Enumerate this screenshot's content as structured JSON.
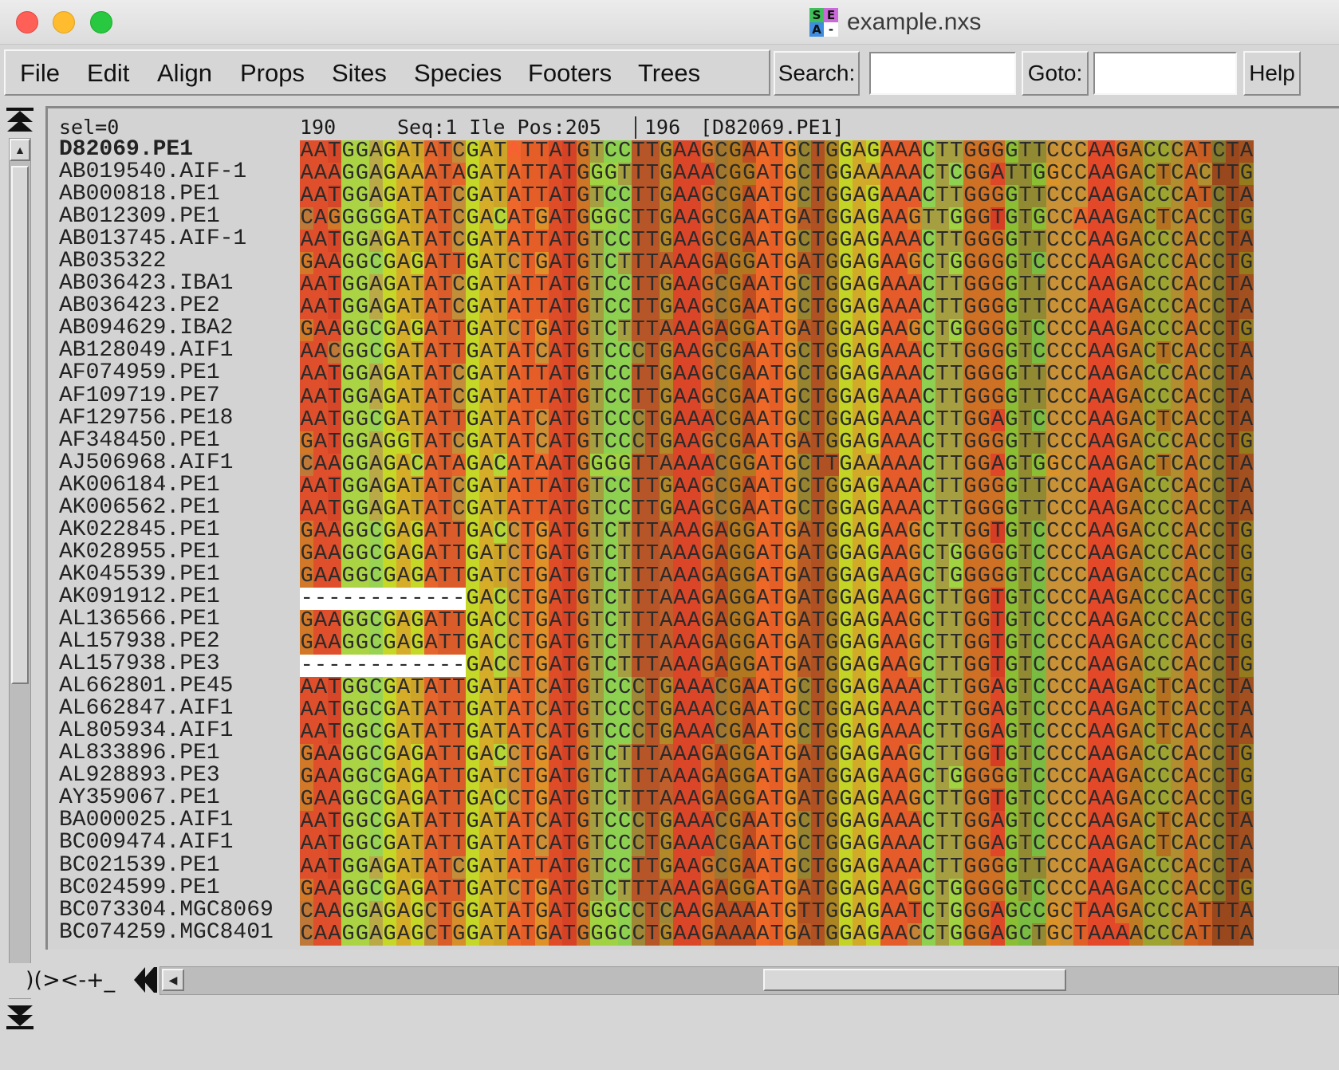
{
  "window": {
    "title": "example.nxs",
    "icon_letters": [
      "S",
      "E",
      "A",
      "-"
    ]
  },
  "menu": {
    "items": [
      "File",
      "Edit",
      "Align",
      "Props",
      "Sites",
      "Species",
      "Footers",
      "Trees"
    ],
    "search_label": "Search:",
    "search_value": "",
    "goto_label": "Goto:",
    "goto_value": "",
    "help_label": "Help"
  },
  "status": {
    "selection": "sel=0",
    "column_start": "190",
    "cursor_info": "Seq:1 Ile Pos:205",
    "cursor_column": "196",
    "cursor_sequence": "[D82069.PE1]"
  },
  "bottom": {
    "gap_symbols": ")(><-+_"
  },
  "colors": {
    "A": "#ed5c2c",
    "C": "#8ed150",
    "G": "#c3d525",
    "T": "#d34125",
    "accent_sequence_highlight": "#111111"
  },
  "alignment": {
    "column_palette": [
      "#d8482a",
      "#9ed455",
      "#c8d928",
      "#e06a2e",
      "#c8d928",
      "#ee6e2a",
      "#d64326",
      "#8ed150",
      "#a7602a",
      "#d33a26",
      "#a9461e",
      "#ee6f26",
      "#9c5a20",
      "#c3d427",
      "#e15a28",
      "#8ed150",
      "#d63b24",
      "#6fb13b",
      "#e8702a",
      "#dd3f28",
      "#a58b1e",
      "#c46a1e",
      "#7a4a18"
    ],
    "rows": [
      {
        "name": "D82069.PE1",
        "seq": "AATGGAGATATCGATATTATGTCCTTGAAGCGAATGCTGGAGAAACTTGGGGTTCCCAAGACCCATCTA",
        "ref": true,
        "cursor": 15
      },
      {
        "name": "AB019540.AIF-1",
        "seq": "AAAGGAGAAATAGATATTATGGGTTTGAAACGGATGCTGGAAAAACTCGGATTGGCCAAGACTCACTTG"
      },
      {
        "name": "AB000818.PE1",
        "seq": "AATGGAGATATCGATATTATGTCCTTGAAGCGAATGCTGGAGAAACTTGGGGTTCCCAAGACCCATCTA"
      },
      {
        "name": "AB012309.PE1",
        "seq": "CAGGGGGATATCGACATGATGGGCTTGAAGCGAATGATGGAGAAGTTGGGTGTGCCAAAGACTCACCTG"
      },
      {
        "name": "AB013745.AIF-1",
        "seq": "AATGGAGATATCGATATTATGTCCTTGAAGCGAATGCTGGAGAAACTTGGGGTTCCCAAGACCCACCTA"
      },
      {
        "name": "AB035322",
        "seq": "GAAGGCGAGATTGATCTGATGTCTTTAAAGAGGATGATGGAGAAGCTGGGGGTCCCCAAGACCCACCTG"
      },
      {
        "name": "AB036423.IBA1",
        "seq": "AATGGAGATATCGATATTATGTCCTTGAAGCGAATGCTGGAGAAACTTGGGGTTCCCAAGACCCACCTA"
      },
      {
        "name": "AB036423.PE2",
        "seq": "AATGGAGATATCGATATTATGTCCTTGAAGCGAATGCTGGAGAAACTTGGGGTTCCCAAGACCCACCTA"
      },
      {
        "name": "AB094629.IBA2",
        "seq": "GAAGGCGAGATTGATCTGATGTCTTTAAAGAGGATGATGGAGAAGCTGGGGGTCCCCAAGACCCACCTG"
      },
      {
        "name": "AB128049.AIF1",
        "seq": "AACGGCGATATTGATATCATGTCCCTGAAGCGAATGCTGGAGAAACTTGGGGTCCCCAAGACTCACCTA"
      },
      {
        "name": "AF074959.PE1",
        "seq": "AATGGAGATATCGATATTATGTCCTTGAAGCGAATGCTGGAGAAACTTGGGGTTCCCAAGACCCACCTA"
      },
      {
        "name": "AF109719.PE7",
        "seq": "AATGGAGATATCGATATTATGTCCTTGAAGCGAATGCTGGAGAAACTTGGGGTTCCCAAGACCCACCTA"
      },
      {
        "name": "AF129756.PE18",
        "seq": "AATGGCGATATTGATATCATGTCCCTGAAACGAATGCTGGAGAAACTTGGAGTCCCCAAGACTCACCTA"
      },
      {
        "name": "AF348450.PE1",
        "seq": "GATGGAGGTATCGATATCATGTCCCTGAAGCGAATGATGGAGAAACTTGGGGTTCCCAAGACCCACCTG"
      },
      {
        "name": "AJ506968.AIF1",
        "seq": "CAAGGAGACATAGACATAATGGGGTTAAAACGGATGCTTGAAAAACTTGGAGTGGCCAAGACTCACCTA"
      },
      {
        "name": "AK006184.PE1",
        "seq": "AATGGAGATATCGATATTATGTCCTTGAAGCGAATGCTGGAGAAACTTGGGGTTCCCAAGACCCACCTA"
      },
      {
        "name": "AK006562.PE1",
        "seq": "AATGGAGATATCGATATTATGTCCTTGAAGCGAATGCTGGAGAAACTTGGGGTTCCCAAGACCCACCTA"
      },
      {
        "name": "AK022845.PE1",
        "seq": "GAAGGCGAGATTGACCTGATGTCTTTAAAGAGGATGATGGAGAAGCTTGGTGTCCCCAAGACCCACCTG"
      },
      {
        "name": "AK028955.PE1",
        "seq": "GAAGGCGAGATTGATCTGATGTCTTTAAAGAGGATGATGGAGAAGCTGGGGGTCCCCAAGACCCACCTG"
      },
      {
        "name": "AK045539.PE1",
        "seq": "GAAGGCGAGATTGATCTGATGTCTTTAAAGAGGATGATGGAGAAGCTGGGGGTCCCCAAGACCCACCTG"
      },
      {
        "name": "AK091912.PE1",
        "seq": "------------GACCTGATGTCTTTAAAGAGGATGATGGAGAAGCTTGGTGTCCCCAAGACCCACCTG"
      },
      {
        "name": "AL136566.PE1",
        "seq": "GAAGGCGAGATTGACCTGATGTCTTTAAAGAGGATGATGGAGAAGCTTGGTGTCCCCAAGACCCACCTG"
      },
      {
        "name": "AL157938.PE2",
        "seq": "GAAGGCGAGATTGACCTGATGTCTTTAAAGAGGATGATGGAGAAGCTTGGTGTCCCCAAGACCCACCTG"
      },
      {
        "name": "AL157938.PE3",
        "seq": "------------GACCTGATGTCTTTAAAGAGGATGATGGAGAAGCTTGGTGTCCCCAAGACCCACCTG"
      },
      {
        "name": "AL662801.PE45",
        "seq": "AATGGCGATATTGATATCATGTCCCTGAAACGAATGCTGGAGAAACTTGGAGTCCCCAAGACTCACCTA"
      },
      {
        "name": "AL662847.AIF1",
        "seq": "AATGGCGATATTGATATCATGTCCCTGAAACGAATGCTGGAGAAACTTGGAGTCCCCAAGACTCACCTA"
      },
      {
        "name": "AL805934.AIF1",
        "seq": "AATGGCGATATTGATATCATGTCCCTGAAACGAATGCTGGAGAAACTTGGAGTCCCCAAGACTCACCTA"
      },
      {
        "name": "AL833896.PE1",
        "seq": "GAAGGCGAGATTGACCTGATGTCTTTAAAGAGGATGATGGAGAAGCTTGGTGTCCCCAAGACCCACCTG"
      },
      {
        "name": "AL928893.PE3",
        "seq": "GAAGGCGAGATTGATCTGATGTCTTTAAAGAGGATGATGGAGAAGCTGGGGGTCCCCAAGACCCACCTG"
      },
      {
        "name": "AY359067.PE1",
        "seq": "GAAGGCGAGATTGACCTGATGTCTTTAAAGAGGATGATGGAGAAGCTTGGTGTCCCCAAGACCCACCTG"
      },
      {
        "name": "BA000025.AIF1",
        "seq": "AATGGCGATATTGATATCATGTCCCTGAAACGAATGCTGGAGAAACTTGGAGTCCCCAAGACTCACCTA"
      },
      {
        "name": "BC009474.AIF1",
        "seq": "AATGGCGATATTGATATCATGTCCCTGAAACGAATGCTGGAGAAACTTGGAGTCCCCAAGACTCACCTA"
      },
      {
        "name": "BC021539.PE1",
        "seq": "AATGGAGATATCGATATTATGTCCTTGAAGCGAATGCTGGAGAAACTTGGGGTTCCCAAGACCCACCTA"
      },
      {
        "name": "BC024599.PE1",
        "seq": "GAAGGCGAGATTGATCTGATGTCTTTAAAGAGGATGATGGAGAAGCTGGGGGTCCCCAAGACCCACCTG"
      },
      {
        "name": "BC073304.MGC8069",
        "seq": "CAAGGAGAGCTGGATATGATGGGCCTCAAGAAAATGTTGGAGAATCTGGGAGCCGCTAAGACCCATTTA"
      },
      {
        "name": "BC074259.MGC8401",
        "seq": "CAAGGAGAGCTGGATATGATGGGCCTGAAGAAAATGATGGAGAACCTGGGAGCTGCTAAAACCCATTTA"
      }
    ]
  }
}
